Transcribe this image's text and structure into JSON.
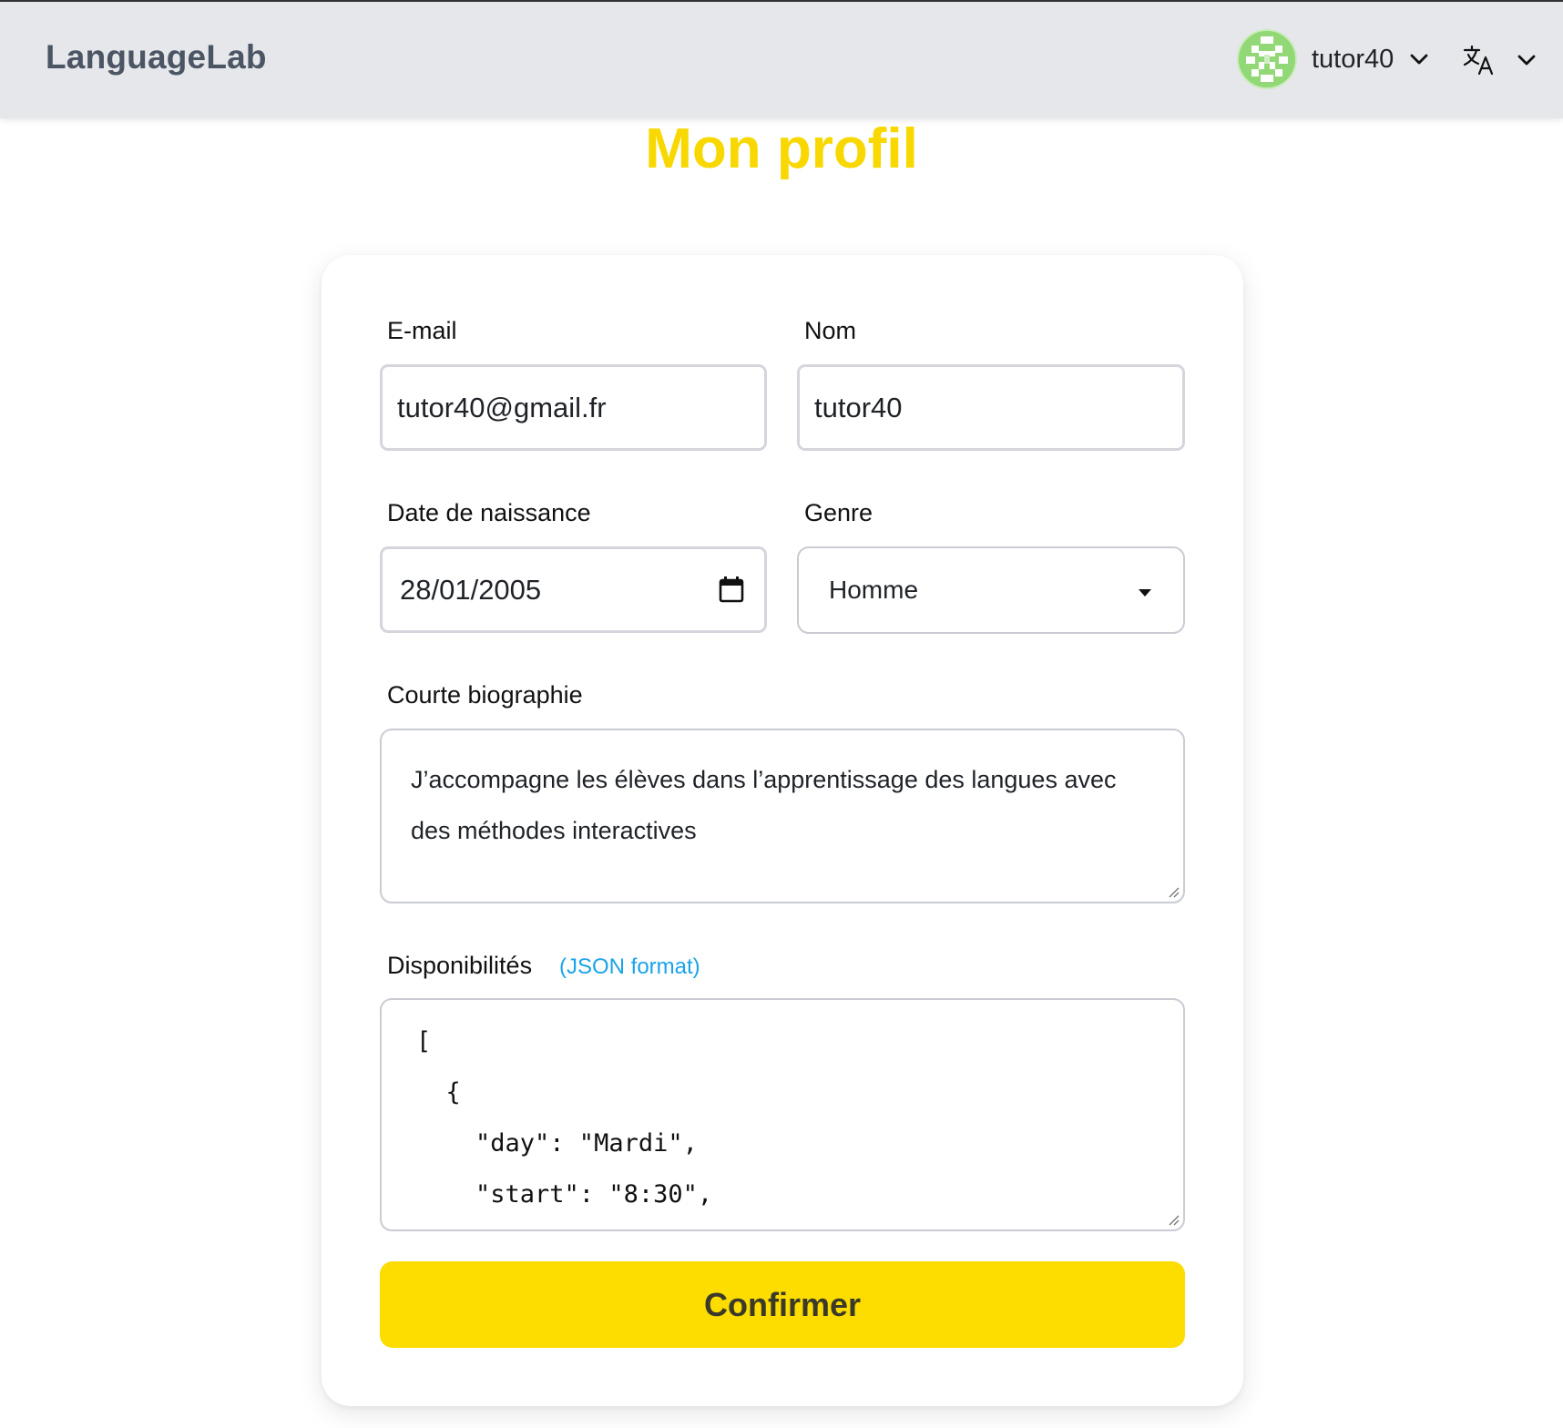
{
  "header": {
    "brand": "LanguageLab",
    "username": "tutor40"
  },
  "page": {
    "title": "Mon profil"
  },
  "form": {
    "email_label": "E-mail",
    "email_value": "tutor40@gmail.fr",
    "name_label": "Nom",
    "name_value": "tutor40",
    "birthdate_label": "Date de naissance",
    "birthdate_value": "28/01/2005",
    "gender_label": "Genre",
    "gender_value": "Homme",
    "bio_label": "Courte biographie",
    "bio_value": "J’accompagne les élèves dans l’apprentissage des langues avec des méthodes interactives",
    "availability_label": "Disponibilités",
    "availability_hint": "(JSON format)",
    "availability_lines": [
      "[",
      "  {",
      "    \"day\": \"Mardi\",",
      "    \"start\": \"8:30\","
    ],
    "confirm_label": "Confirmer"
  },
  "colors": {
    "accent_yellow": "#fddc00",
    "title_yellow": "#f8d800",
    "link_blue": "#1aa3e8",
    "header_bg": "#e5e7eb"
  },
  "icons": {
    "avatar": "identicon-avatar",
    "user_chevron": "chevron-down-icon",
    "language": "translate-icon",
    "language_chevron": "chevron-down-icon",
    "date": "calendar-icon",
    "select": "caret-down-icon",
    "resize": "resize-handle-icon"
  }
}
